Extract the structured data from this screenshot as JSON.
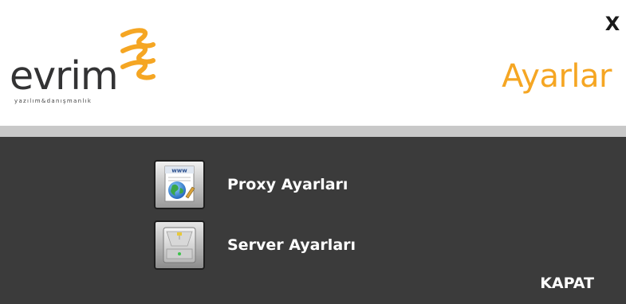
{
  "header": {
    "brand": "evrim",
    "tagline": "yazılım&danışmanlık",
    "title": "Ayarlar",
    "close_label": "X",
    "accent_color": "#f5a623"
  },
  "menu": {
    "items": [
      {
        "label": "Proxy Ayarları",
        "icon": "www-globe-icon"
      },
      {
        "label": "Server Ayarları",
        "icon": "server-drive-icon"
      }
    ]
  },
  "footer": {
    "close_button_label": "KAPAT"
  }
}
